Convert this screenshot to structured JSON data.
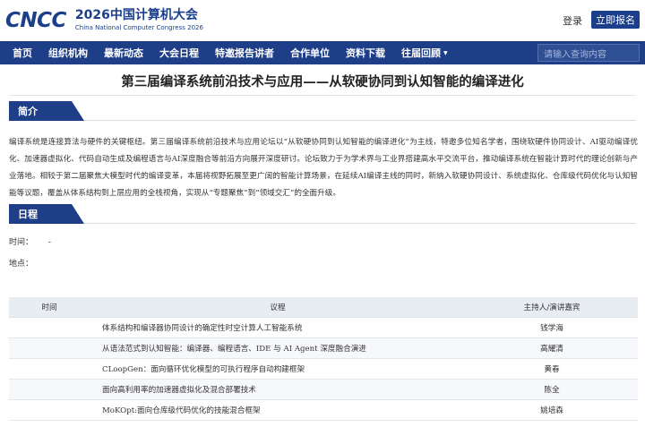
{
  "header": {
    "logo_mark": "CNCC",
    "logo_title": "2026中国计算机大会",
    "logo_subtitle": "China National Computer Congress 2026",
    "login_label": "登录",
    "register_label": "立即报名"
  },
  "nav": {
    "items": [
      {
        "label": "首页"
      },
      {
        "label": "组织机构"
      },
      {
        "label": "最新动态"
      },
      {
        "label": "大会日程"
      },
      {
        "label": "特邀报告讲者"
      },
      {
        "label": "合作单位"
      },
      {
        "label": "资料下载"
      },
      {
        "label": "往届回顾"
      }
    ],
    "search_placeholder": "请输入查询内容"
  },
  "page": {
    "title": "第三届编译系统前沿技术与应用——从软硬协同到认知智能的编译进化"
  },
  "intro": {
    "heading": "简介",
    "text": "编译系统是连接算法与硬件的关键枢纽。第三届编译系统前沿技术与应用论坛以“从软硬协同到认知智能的编译进化”为主线，特邀多位知名学者，围绕软硬件协同设计、AI驱动编译优化、加速器虚拟化、代码自动生成及编程语言与AI深度融合等前沿方向展开深度研讨。论坛致力于为学术界与工业界搭建高水平交流平台，推动编译系统在智能计算时代的理论创新与产业落地。相较于第二届聚焦大模型时代的编译变革，本届将视野拓展至更广阔的智能计算场景，在延续AI编译主线的同时，新纳入软硬协同设计、系统虚拟化、仓库级代码优化与认知智能等议题，覆盖从体系结构到上层应用的全栈视角，实现从“专题聚焦”到“领域交汇”的全面升级。"
  },
  "schedule": {
    "heading": "日程",
    "time_label": "时间：",
    "time_value": "-",
    "place_label": "地点："
  },
  "agenda": {
    "headers": {
      "time": "时间",
      "topic": "议程",
      "host": "主持人/演讲嘉宾"
    },
    "rows": [
      {
        "time": "",
        "topic": "体系结构和编译器协同设计的确定性时空计算人工智能系统",
        "host": "钱学海"
      },
      {
        "time": "",
        "topic": "从语法范式到认知智能：编译器、编程语言、IDE 与 AI Agent 深度融合演进",
        "host": "高耀清"
      },
      {
        "time": "",
        "topic": "CLoopGen：面向循环优化模型的可执行程序自动构建框架",
        "host": "黄春"
      },
      {
        "time": "",
        "topic": "面向高利用率的加速器虚拟化及混合部署技术",
        "host": "陈全"
      },
      {
        "time": "",
        "topic": "MoKOpt:面向仓库级代码优化的技能混合框架",
        "host": "姚培森"
      }
    ]
  }
}
